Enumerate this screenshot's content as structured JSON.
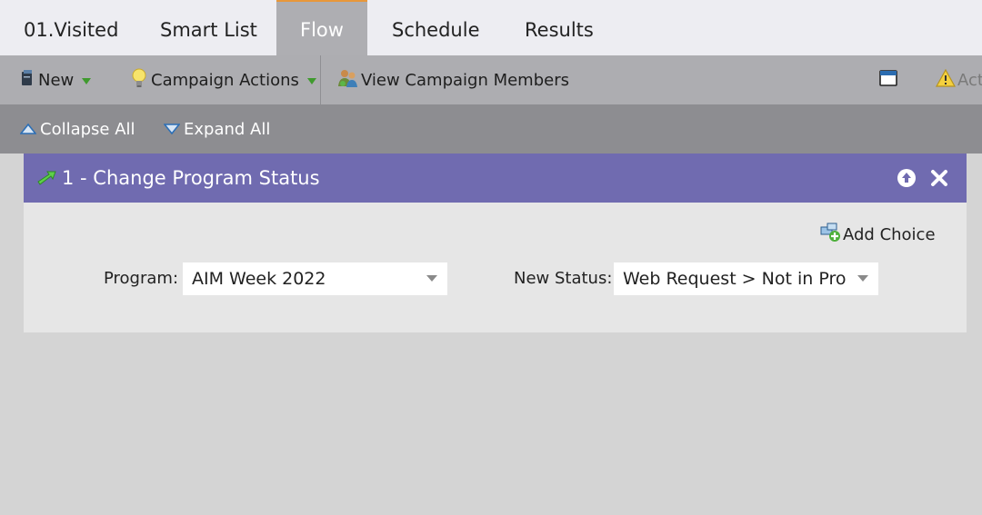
{
  "tabs": [
    {
      "label": "01.Visited"
    },
    {
      "label": "Smart List"
    },
    {
      "label": "Flow"
    },
    {
      "label": "Schedule"
    },
    {
      "label": "Results"
    }
  ],
  "active_tab": "Flow",
  "toolbar": {
    "new_label": "New",
    "campaign_actions_label": "Campaign Actions",
    "view_members_label": "View Campaign Members",
    "activate_label": "Act"
  },
  "subbar": {
    "collapse_label": "Collapse All",
    "expand_label": "Expand All"
  },
  "flow_step": {
    "title": "1 - Change Program Status",
    "add_choice_label": "Add Choice",
    "program_label": "Program:",
    "program_value": "AIM Week 2022",
    "new_status_label": "New Status:",
    "new_status_value": "Web Request > Not in Program"
  },
  "colors": {
    "tab_active_bg": "#aeaeb2",
    "tab_active_accent": "#e8973a",
    "step_header_bg": "#706bb0",
    "toolbar_bg": "#adadb1",
    "subbar_bg": "#8d8d91"
  }
}
